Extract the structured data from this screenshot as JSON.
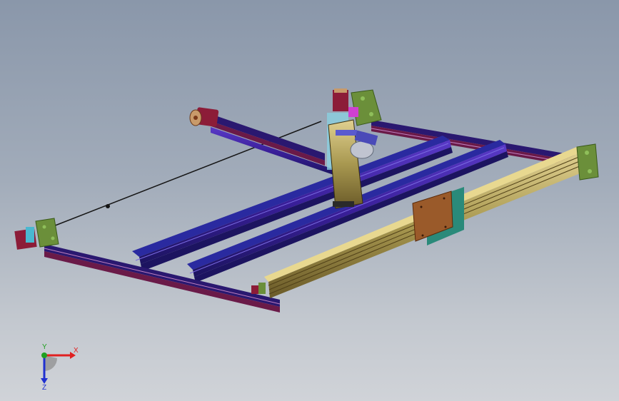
{
  "viewport": {
    "background_top": "#8a97aa",
    "background_bottom": "#d0d3d8"
  },
  "model": {
    "description_icon": "cnc-gantry-assembly-icon",
    "colors": {
      "rail_purple": "#3a1f9a",
      "rail_dark": "#1c1460",
      "rail_maroon": "#6a1a48",
      "plate_green": "#6b8f3a",
      "plate_green_light": "#8fbf5a",
      "motor_red": "#8c1c38",
      "motor_tan": "#c89a6a",
      "motor_blue": "#4ab8d0",
      "brown_plate": "#9a5a2a",
      "teal_plate": "#2a8a7a",
      "gold_rail": "#c8b870",
      "spindle_silver": "#c0c4d0",
      "zaxis_gold": "#a89850",
      "cyan_bracket": "#8ad0e0",
      "cable_black": "#151515"
    }
  },
  "triad": {
    "x_label": "X",
    "y_label": "Y",
    "z_label": "Z",
    "x_color": "#e02020",
    "y_color": "#20a020",
    "z_color": "#2030d0"
  }
}
